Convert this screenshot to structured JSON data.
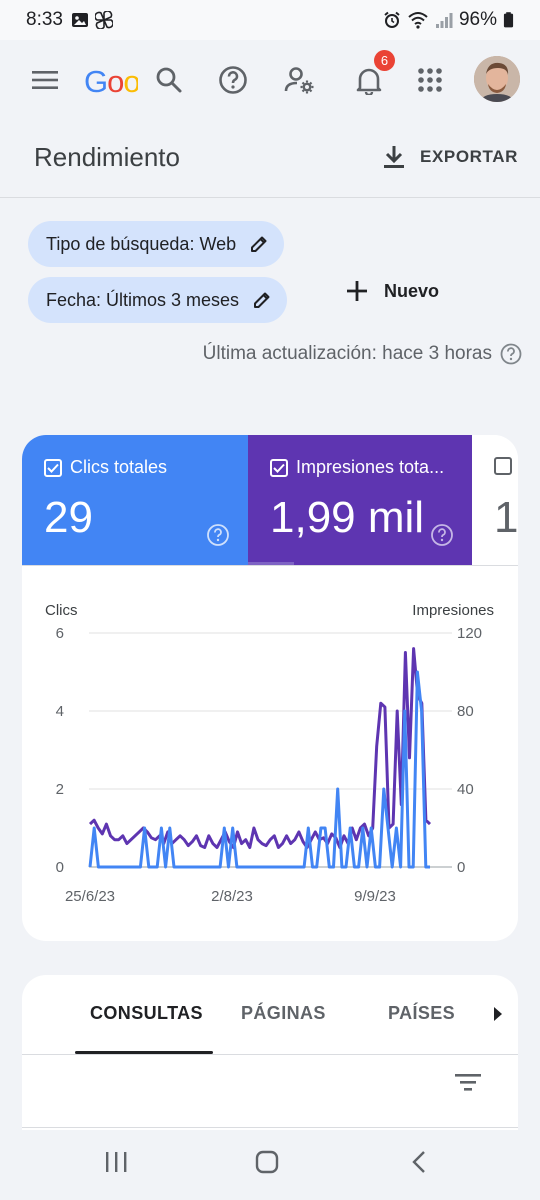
{
  "status_bar": {
    "time": "8:33",
    "battery": "96%"
  },
  "app_bar": {
    "logo_text": "Google",
    "notification_count": "6"
  },
  "page": {
    "title": "Rendimiento",
    "export_label": "EXPORTAR"
  },
  "filters": {
    "search_type_chip": "Tipo de búsqueda: Web",
    "date_chip": "Fecha: Últimos 3 meses",
    "new_label": "Nuevo",
    "last_updated": "Última actualización: hace 3 horas"
  },
  "metrics": {
    "clicks_label": "Clics totales",
    "clicks_value": "29",
    "impressions_label": "Impresiones tota...",
    "impressions_value": "1,99 mil",
    "third_value": "1"
  },
  "colors": {
    "clicks": "#4285f4",
    "impressions": "#5e35b1",
    "chip_bg": "#d4e3fc"
  },
  "chart_data": {
    "type": "line",
    "left_axis_label": "Clics",
    "right_axis_label": "Impresiones",
    "left_ylim": [
      0,
      6
    ],
    "right_ylim": [
      0,
      120
    ],
    "left_ticks": [
      "6",
      "4",
      "2",
      "0"
    ],
    "right_ticks": [
      "120",
      "80",
      "40",
      "0"
    ],
    "x_tick_labels": [
      "25/6/23",
      "2/8/23",
      "9/9/23"
    ],
    "grid": true,
    "series": [
      {
        "name": "Clics",
        "axis": "left",
        "color": "#4285f4",
        "values": [
          0,
          1,
          0,
          0,
          0,
          0,
          0,
          0,
          0,
          0,
          0,
          0,
          0,
          1,
          0,
          0,
          0,
          1,
          0,
          1,
          0,
          0,
          0,
          0,
          0,
          0,
          0,
          0,
          0,
          0,
          0,
          0,
          1,
          0,
          1,
          0,
          0,
          0,
          0,
          0,
          0,
          0,
          0,
          0,
          0,
          0,
          0,
          0,
          0,
          0,
          0,
          0,
          1,
          0,
          0,
          1,
          1,
          0,
          0,
          2,
          0,
          0,
          1,
          0,
          0,
          1,
          0,
          1,
          0,
          0,
          2,
          1,
          0,
          1,
          0,
          4,
          0,
          0,
          5,
          4,
          0,
          0
        ]
      },
      {
        "name": "Impresiones",
        "axis": "right",
        "color": "#5e35b1",
        "values": [
          22,
          24,
          20,
          17,
          22,
          16,
          14,
          14,
          16,
          12,
          14,
          16,
          18,
          20,
          18,
          15,
          14,
          16,
          12,
          18,
          12,
          14,
          16,
          14,
          11,
          13,
          16,
          11,
          10,
          16,
          12,
          10,
          14,
          18,
          13,
          10,
          18,
          12,
          14,
          10,
          20,
          14,
          12,
          11,
          14,
          16,
          10,
          12,
          16,
          12,
          14,
          18,
          13,
          10,
          14,
          18,
          14,
          15,
          12,
          17,
          15,
          10,
          16,
          12,
          20,
          14,
          20,
          22,
          16,
          20,
          62,
          84,
          82,
          20,
          22,
          80,
          32,
          110,
          56,
          112,
          88,
          84,
          24,
          22
        ]
      }
    ]
  },
  "tabs": {
    "items": [
      "CONSULTAS",
      "PÁGINAS",
      "PAÍSES"
    ],
    "active": "CONSULTAS"
  }
}
